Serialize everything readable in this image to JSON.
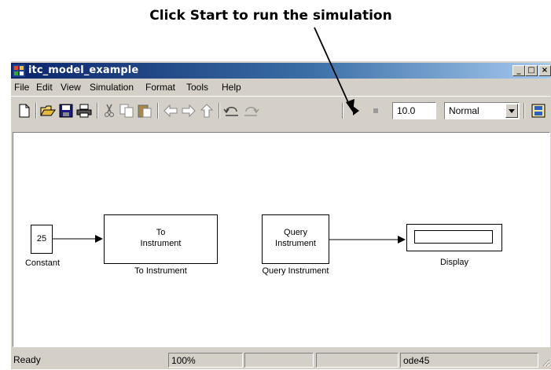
{
  "annotation": {
    "text": "Click Start to run the simulation"
  },
  "window": {
    "title": "itc_model_example",
    "caption_buttons": [
      "_",
      "□",
      "×"
    ]
  },
  "menu": [
    "File",
    "Edit",
    "View",
    "Simulation",
    "Format",
    "Tools",
    "Help"
  ],
  "toolbar": {
    "icons": [
      "new-icon",
      "open-icon",
      "save-icon",
      "print-icon",
      "cut-icon",
      "copy-icon",
      "paste-icon",
      "back-icon",
      "forward-icon",
      "up-icon",
      "undo-icon",
      "redo-icon",
      "start-icon",
      "stop-icon",
      "library-icon"
    ],
    "stop_time": "10.0",
    "sim_mode": "Normal"
  },
  "model": {
    "blocks": [
      {
        "id": "constant",
        "text": "25",
        "label": "Constant"
      },
      {
        "id": "to_instrument",
        "text_lines": [
          "To",
          "Instrument"
        ],
        "label": "To Instrument"
      },
      {
        "id": "query_instrument",
        "text_lines": [
          "Query",
          "Instrument"
        ],
        "label": "Query Instrument"
      },
      {
        "id": "display",
        "text": "",
        "label": "Display"
      }
    ]
  },
  "status": {
    "state": "Ready",
    "zoom": "100%",
    "solver": "ode45"
  }
}
